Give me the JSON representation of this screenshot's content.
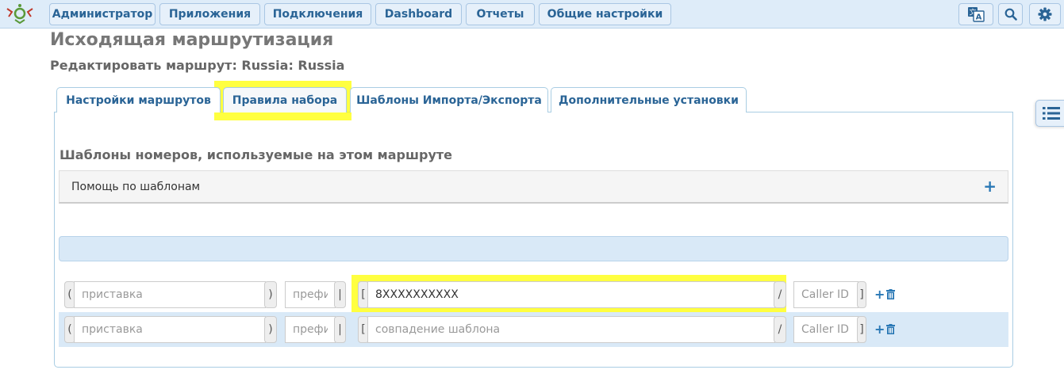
{
  "nav": {
    "items": [
      {
        "label": "Администратор"
      },
      {
        "label": "Приложения"
      },
      {
        "label": "Подключения"
      },
      {
        "label": "Dashboard"
      },
      {
        "label": "Отчеты"
      },
      {
        "label": "Общие настройки"
      }
    ],
    "icons": [
      "translate-icon",
      "search-icon",
      "gear-icon"
    ]
  },
  "page": {
    "title": "Исходящая маршрутизация",
    "subtitle": "Редактировать маршрут: Russia: Russia"
  },
  "tabs": [
    {
      "label": "Настройки маршрутов",
      "active": false
    },
    {
      "label": "Правила набора",
      "active": true
    },
    {
      "label": "Шаблоны Импорта/Экспорта",
      "active": false
    },
    {
      "label": "Дополнительные установки",
      "active": false
    }
  ],
  "section": {
    "title": "Шаблоны номеров, используемые на этом маршруте",
    "help_label": "Помощь по шаблонам",
    "help_toggle": "+"
  },
  "rows": [
    {
      "prepend_open": "(",
      "prepend_placeholder": "приставка",
      "prepend_value": "",
      "prepend_close": ")",
      "prefix_placeholder": "префикс",
      "prefix_value": "",
      "prefix_sep": "|",
      "pattern_open": "[",
      "pattern_placeholder": "совпадение шаблона",
      "pattern_value": "8XXXXXXXXXX",
      "pattern_sep": "/",
      "callerid_placeholder": "Caller ID",
      "callerid_value": "",
      "callerid_close": "]"
    },
    {
      "prepend_open": "(",
      "prepend_placeholder": "приставка",
      "prepend_value": "",
      "prepend_close": ")",
      "prefix_placeholder": "префикс",
      "prefix_value": "",
      "prefix_sep": "|",
      "pattern_open": "[",
      "pattern_placeholder": "совпадение шаблона",
      "pattern_value": "",
      "pattern_sep": "/",
      "callerid_placeholder": "Caller ID",
      "callerid_value": "",
      "callerid_close": "]"
    }
  ],
  "colors": {
    "accent": "#2a6496",
    "nav_bg": "#deecf9",
    "highlight": "#ffff00"
  }
}
